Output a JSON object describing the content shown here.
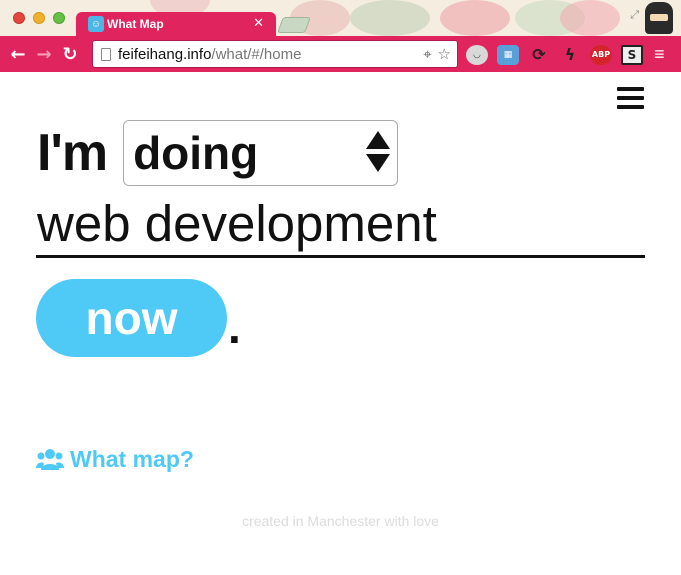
{
  "browser": {
    "tab_title": "What Map",
    "tab_favicon": "☺",
    "url_host": "feifeihang.info",
    "url_path": "/what/#/home",
    "accent_color": "#e0245e",
    "extensions": [
      "pocket-icon",
      "tabs-icon",
      "sync-icon",
      "bolt-icon",
      "ABP",
      "S"
    ]
  },
  "page": {
    "prefix": "I'm",
    "verb_select": {
      "selected": "doing"
    },
    "activity_value": "web development",
    "now_button_label": "now",
    "period": ".",
    "whatmap_link": "What map?",
    "footer": "created in Manchester with love",
    "accent_color": "#4fc9f5"
  }
}
